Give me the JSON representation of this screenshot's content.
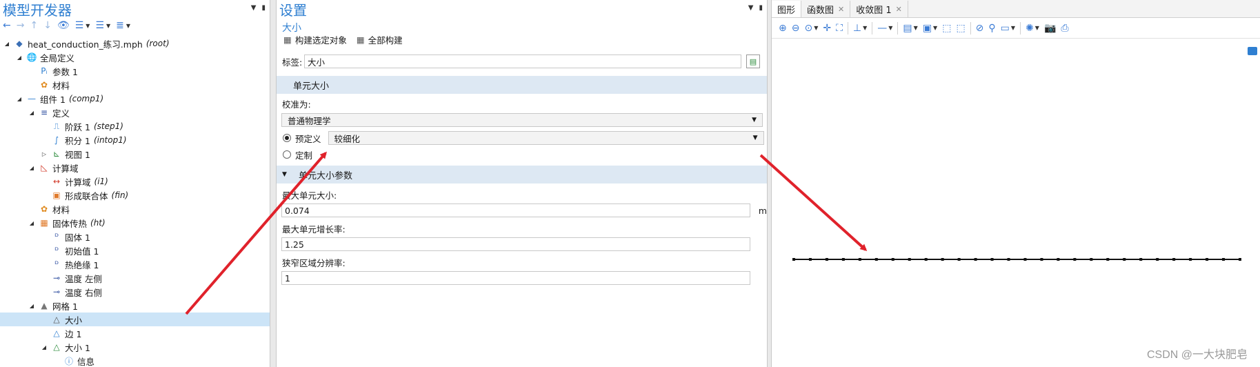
{
  "model_builder": {
    "title": "模型开发器",
    "tree": [
      {
        "level": 0,
        "expanded": true,
        "icon": "root-model-icon",
        "label": "heat_conduction_练习.mph",
        "tag": "(root)"
      },
      {
        "level": 1,
        "expanded": true,
        "icon": "globe-icon",
        "label": "全局定义",
        "tag": ""
      },
      {
        "level": 2,
        "expanded": null,
        "icon": "parameters-icon",
        "label": "参数 1",
        "tag": ""
      },
      {
        "level": 2,
        "expanded": null,
        "icon": "materials-icon",
        "label": "材料",
        "tag": ""
      },
      {
        "level": 1,
        "expanded": true,
        "icon": "component-icon",
        "label": "组件 1",
        "tag": "(comp1)"
      },
      {
        "level": 2,
        "expanded": true,
        "icon": "definitions-icon",
        "label": "定义",
        "tag": ""
      },
      {
        "level": 3,
        "expanded": null,
        "icon": "step-function-icon",
        "label": "阶跃 1",
        "tag": "(step1)"
      },
      {
        "level": 3,
        "expanded": null,
        "icon": "integration-icon",
        "label": "积分 1",
        "tag": "(intop1)"
      },
      {
        "level": 3,
        "expanded": false,
        "icon": "view-icon",
        "label": "视图 1",
        "tag": ""
      },
      {
        "level": 2,
        "expanded": true,
        "icon": "geometry-icon",
        "label": "计算域",
        "tag": ""
      },
      {
        "level": 3,
        "expanded": null,
        "icon": "interval-icon",
        "label": "计算域",
        "tag": "(i1)"
      },
      {
        "level": 3,
        "expanded": null,
        "icon": "form-union-icon",
        "label": "形成联合体",
        "tag": "(fin)"
      },
      {
        "level": 2,
        "expanded": null,
        "icon": "materials-icon",
        "label": "材料",
        "tag": ""
      },
      {
        "level": 2,
        "expanded": true,
        "icon": "heat-transfer-icon",
        "label": "固体传热",
        "tag": "(ht)"
      },
      {
        "level": 3,
        "expanded": null,
        "icon": "domain-node-icon",
        "label": "固体 1",
        "tag": ""
      },
      {
        "level": 3,
        "expanded": null,
        "icon": "domain-node-icon",
        "label": "初始值 1",
        "tag": ""
      },
      {
        "level": 3,
        "expanded": null,
        "icon": "boundary-node-icon",
        "label": "热绝缘 1",
        "tag": ""
      },
      {
        "level": 3,
        "expanded": null,
        "icon": "point-node-icon",
        "label": "温度 左侧",
        "tag": ""
      },
      {
        "level": 3,
        "expanded": null,
        "icon": "point-node-icon",
        "label": "温度 右侧",
        "tag": ""
      },
      {
        "level": 2,
        "expanded": true,
        "icon": "mesh-icon",
        "label": "网格 1",
        "tag": ""
      },
      {
        "level": 3,
        "expanded": null,
        "icon": "mesh-size-icon",
        "label": "大小",
        "tag": "",
        "selected": true
      },
      {
        "level": 3,
        "expanded": null,
        "icon": "mesh-edge-icon",
        "label": "边 1",
        "tag": ""
      },
      {
        "level": 3,
        "expanded": true,
        "icon": "mesh-size-green-icon",
        "label": "大小 1",
        "tag": ""
      },
      {
        "level": 4,
        "expanded": null,
        "icon": "info-icon",
        "label": "信息",
        "tag": ""
      }
    ]
  },
  "settings": {
    "title": "设置",
    "subtitle": "大小",
    "build_selected": "构建选定对象",
    "build_all": "全部构建",
    "label_caption": "标签:",
    "label_value": "大小",
    "section_element_size": "单元大小",
    "calibrate_for_caption": "校准为:",
    "calibrate_for_value": "普通物理学",
    "predefined_label": "预定义",
    "predefined_value": "较细化",
    "custom_label": "定制",
    "section_parameters": "单元大小参数",
    "max_size_caption": "最大单元大小:",
    "max_size_value": "0.074",
    "max_size_unit": "m",
    "growth_rate_caption": "最大单元增长率:",
    "growth_rate_value": "1.25",
    "narrow_region_caption": "狭窄区域分辨率:",
    "narrow_region_value": "1"
  },
  "graphics": {
    "tabs": [
      {
        "label": "图形",
        "active": true,
        "closable": false
      },
      {
        "label": "函数图",
        "active": false,
        "closable": true
      },
      {
        "label": "收敛图 1",
        "active": false,
        "closable": true
      }
    ],
    "mesh_vertices": 28,
    "watermark": "CSDN @一大块肥皂"
  },
  "colors": {
    "accent": "#2f7fd1",
    "selected_row": "#cce4f7",
    "section_bar": "#dde8f3",
    "arrow": "#e0222b"
  }
}
